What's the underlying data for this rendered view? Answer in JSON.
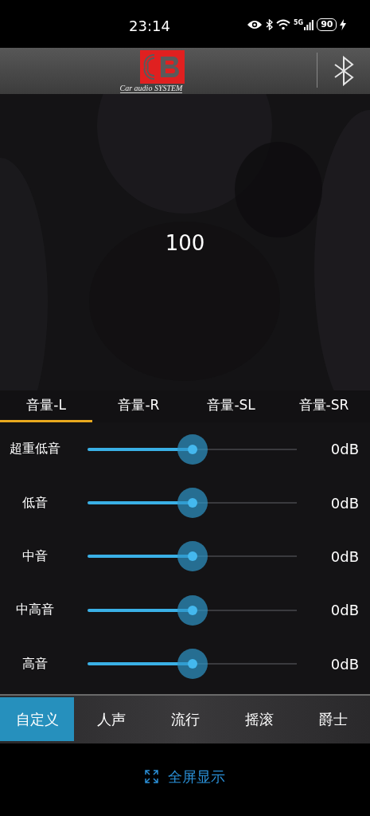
{
  "status_bar": {
    "time": "23:14",
    "network": "5G",
    "battery": "90"
  },
  "header": {
    "logo_text": "Car audio SYSTEM"
  },
  "volume_display": "100",
  "tabs": [
    {
      "label": "音量-L",
      "selected": true
    },
    {
      "label": "音量-R",
      "selected": false
    },
    {
      "label": "音量-SL",
      "selected": false
    },
    {
      "label": "音量-SR",
      "selected": false
    }
  ],
  "bands": [
    {
      "name": "超重低音",
      "level": 0.5,
      "reading": "0dB"
    },
    {
      "name": "低音",
      "level": 0.5,
      "reading": "0dB"
    },
    {
      "name": "中音",
      "level": 0.5,
      "reading": "0dB"
    },
    {
      "name": "中高音",
      "level": 0.5,
      "reading": "0dB"
    },
    {
      "name": "高音",
      "level": 0.5,
      "reading": "0dB"
    }
  ],
  "presets": [
    {
      "label": "自定义",
      "selected": true
    },
    {
      "label": "人声",
      "selected": false
    },
    {
      "label": "流行",
      "selected": false
    },
    {
      "label": "摇滚",
      "selected": false
    },
    {
      "label": "爵士",
      "selected": false
    }
  ],
  "fullscreen_link": "全屏显示"
}
